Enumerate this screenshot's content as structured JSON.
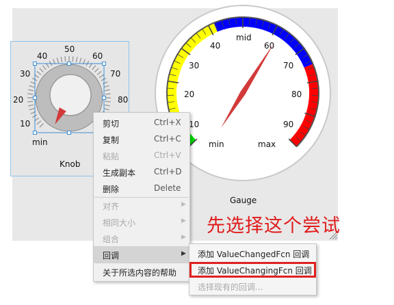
{
  "knob": {
    "ticks": [
      "min",
      "10",
      "20",
      "30",
      "40",
      "50",
      "60",
      "70",
      "80"
    ],
    "caption": "Knob"
  },
  "gauge": {
    "ticks": [
      "10",
      "20",
      "30",
      "40",
      "mid",
      "60",
      "70",
      "80",
      "90",
      "max",
      "min"
    ],
    "caption": "Gauge",
    "colors": {
      "green": "#00dd00",
      "yellow": "#ffff00",
      "blue": "#0000ff",
      "red": "#ff0000",
      "needle": "#d23a3a"
    }
  },
  "annotation": "先选择这个尝试",
  "context_menu": {
    "items": [
      {
        "label": "剪切",
        "shortcut": "Ctrl+X",
        "enabled": true
      },
      {
        "label": "复制",
        "shortcut": "Ctrl+C",
        "enabled": true
      },
      {
        "label": "粘贴",
        "shortcut": "Ctrl+V",
        "enabled": false
      },
      {
        "label": "生成副本",
        "shortcut": "Ctrl+D",
        "enabled": true
      },
      {
        "label": "删除",
        "shortcut": "Delete",
        "enabled": true
      },
      {
        "label": "对齐",
        "enabled": false,
        "submenu": true
      },
      {
        "label": "相同大小",
        "enabled": false,
        "submenu": true
      },
      {
        "label": "组合",
        "enabled": false,
        "submenu": true
      },
      {
        "label": "回调",
        "enabled": true,
        "submenu": true,
        "highlighted": true
      },
      {
        "label": "关于所选内容的帮助",
        "enabled": true
      }
    ]
  },
  "submenu": {
    "items": [
      {
        "label": "添加 ValueChangedFcn 回调",
        "enabled": true
      },
      {
        "label": "添加 ValueChangingFcn 回调",
        "enabled": true,
        "selected": true
      },
      {
        "label": "选择现有的回调...",
        "enabled": false
      }
    ]
  }
}
